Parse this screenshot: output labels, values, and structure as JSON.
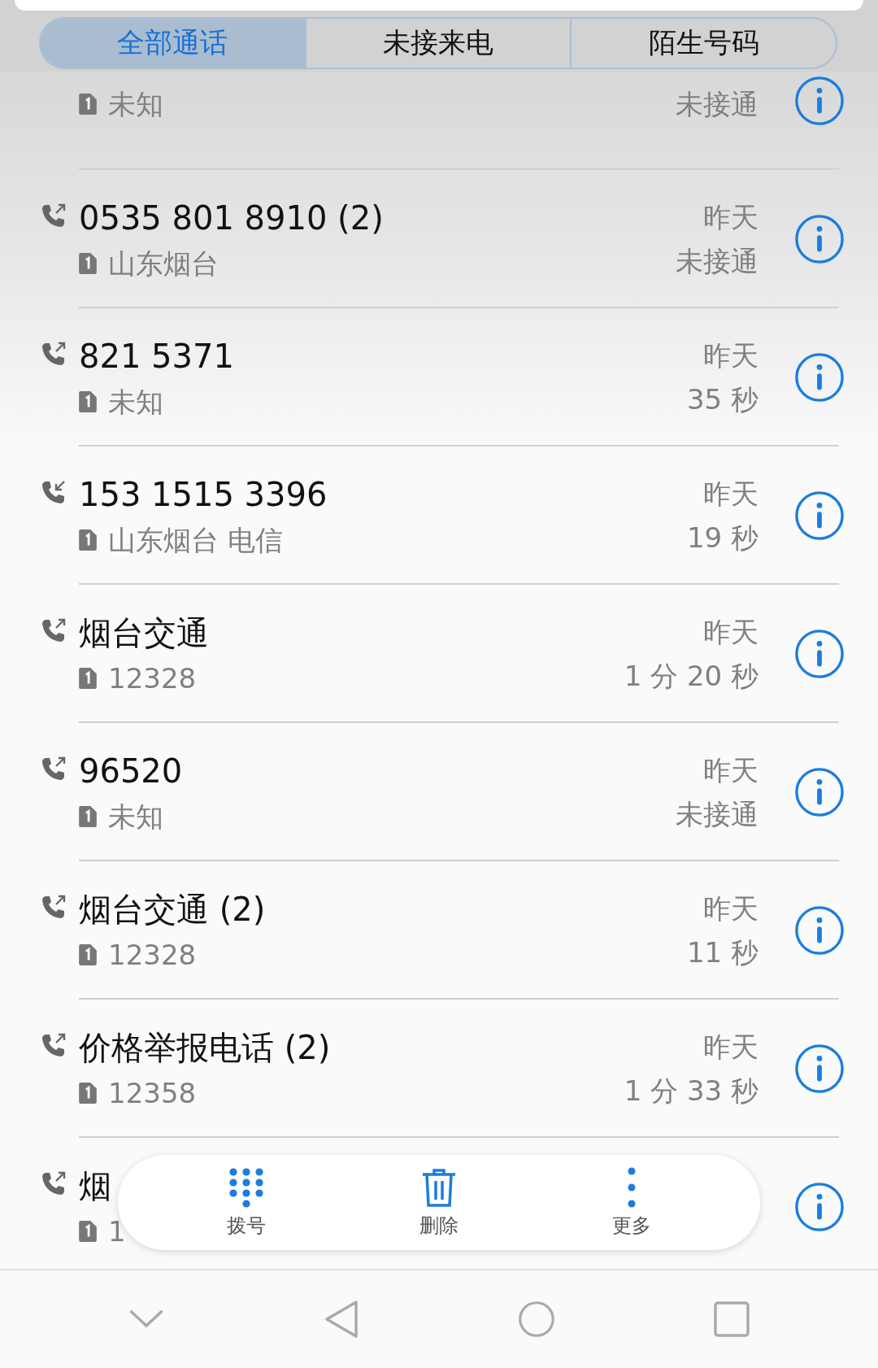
{
  "tabs": [
    {
      "label": "全部通话",
      "selected": true
    },
    {
      "label": "未接来电",
      "selected": false
    },
    {
      "label": "陌生号码",
      "selected": false
    }
  ],
  "calls": [
    {
      "detail": "未知",
      "status": "未接通"
    },
    {
      "kind": "outgoing",
      "name": "0535 801 8910 (2)",
      "detail": "山东烟台",
      "date": "昨天",
      "status": "未接通"
    },
    {
      "kind": "outgoing",
      "name": "821 5371",
      "detail": "未知",
      "date": "昨天",
      "status": "35 秒"
    },
    {
      "kind": "incoming",
      "name": "153 1515 3396",
      "detail": "山东烟台 电信",
      "date": "昨天",
      "status": "19 秒"
    },
    {
      "kind": "outgoing",
      "name": "烟台交通",
      "detail": "12328",
      "date": "昨天",
      "status": "1 分 20 秒"
    },
    {
      "kind": "outgoing",
      "name": "96520",
      "detail": "未知",
      "date": "昨天",
      "status": "未接通"
    },
    {
      "kind": "outgoing",
      "name": "烟台交通 (2)",
      "detail": "12328",
      "date": "昨天",
      "status": "11 秒"
    },
    {
      "kind": "outgoing",
      "name": "价格举报电话 (2)",
      "detail": "12358",
      "date": "昨天",
      "status": "1 分 33 秒"
    },
    {
      "kind": "outgoing",
      "name": "烟",
      "detail": "1"
    }
  ],
  "toolbar": [
    {
      "kind": "dialpad",
      "label": "拨号"
    },
    {
      "kind": "delete",
      "label": "删除"
    },
    {
      "kind": "more",
      "label": "更多"
    }
  ]
}
